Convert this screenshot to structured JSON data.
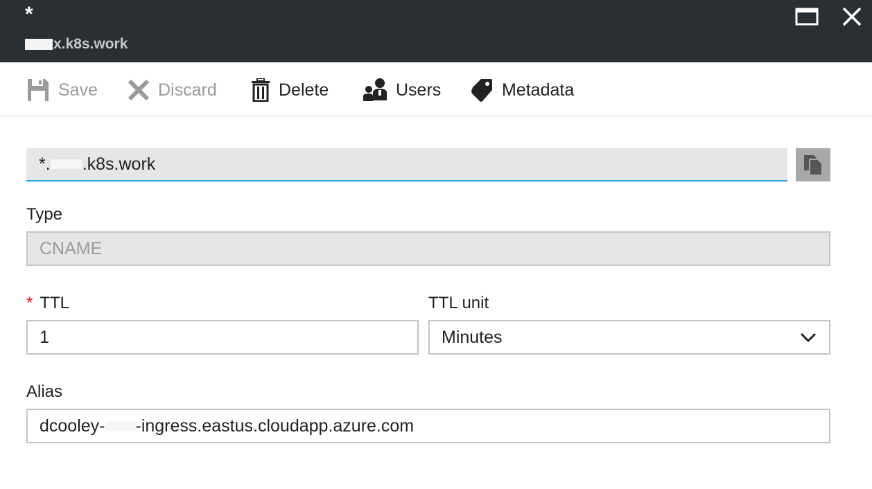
{
  "window": {
    "title": "*",
    "subtitle": "x.k8s.work",
    "maximize_icon": "maximize-icon",
    "close_icon": "close-icon"
  },
  "toolbar": {
    "save_label": "Save",
    "discard_label": "Discard",
    "delete_label": "Delete",
    "users_label": "Users",
    "metadata_label": "Metadata"
  },
  "form": {
    "name": {
      "value_prefix": "*.",
      "value_suffix": ".k8s.work"
    },
    "type": {
      "label": "Type",
      "value": "CNAME"
    },
    "ttl": {
      "required_marker": "*",
      "label": "TTL",
      "value": "1"
    },
    "ttl_unit": {
      "label": "TTL unit",
      "selected": "Minutes"
    },
    "alias": {
      "label": "Alias",
      "value_prefix": "dcooley-",
      "value_suffix": "-ingress.eastus.cloudapp.azure.com"
    }
  },
  "colors": {
    "titlebar_bg": "#2a2f33",
    "accent_border": "#1ba1e2",
    "required": "#e81123",
    "disabled_text": "#9a9a9a"
  }
}
